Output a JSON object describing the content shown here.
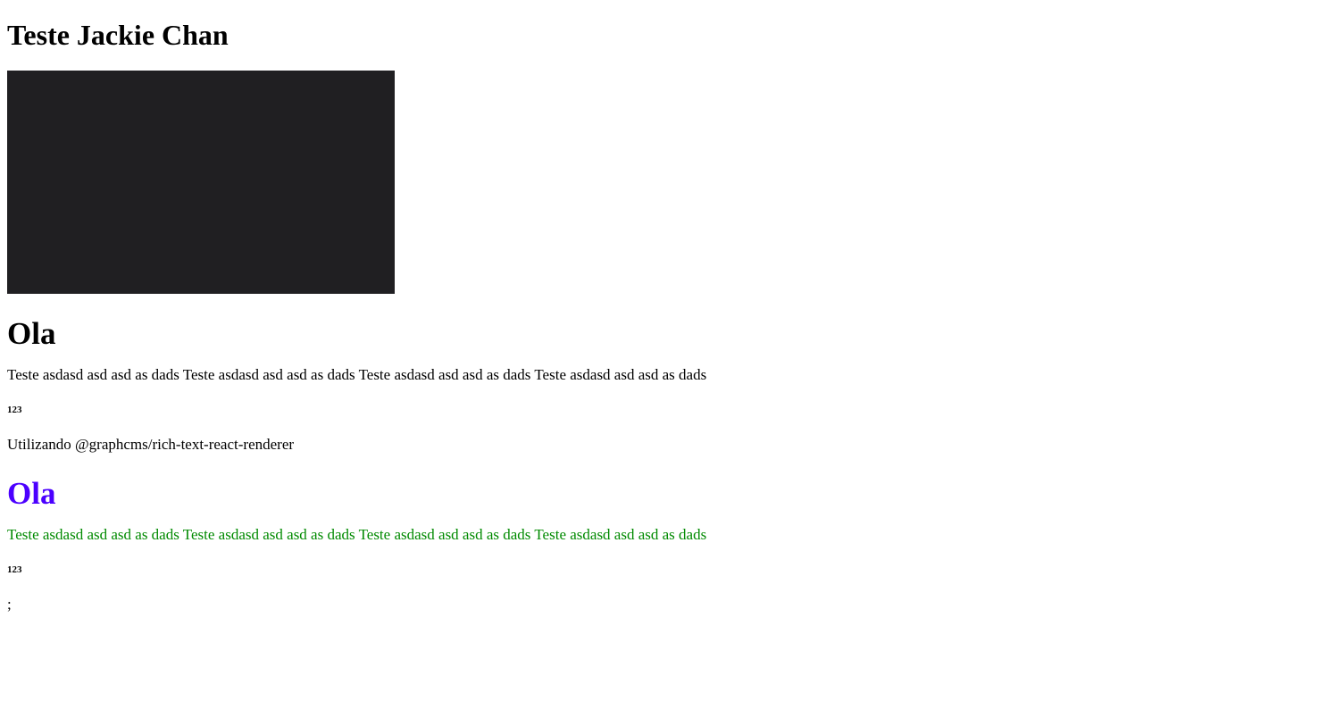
{
  "page": {
    "title": "Teste Jackie Chan",
    "video_background": "#201f22",
    "section1": {
      "heading": "Ola",
      "paragraph": "Teste asdasd asd asd as dads Teste asdasd asd asd as dads Teste asdasd asd asd as dads Teste asdasd asd asd as dads",
      "small_heading": "123",
      "note": "Utilizando @graphcms/rich-text-react-renderer"
    },
    "section2": {
      "heading": "Ola",
      "heading_color": "#4b00ff",
      "paragraph": "Teste asdasd asd asd as dads Teste asdasd asd asd as dads Teste asdasd asd asd as dads Teste asdasd asd asd as dads",
      "paragraph_color": "#008a00",
      "small_heading": "123",
      "trailing_text": ";"
    }
  }
}
